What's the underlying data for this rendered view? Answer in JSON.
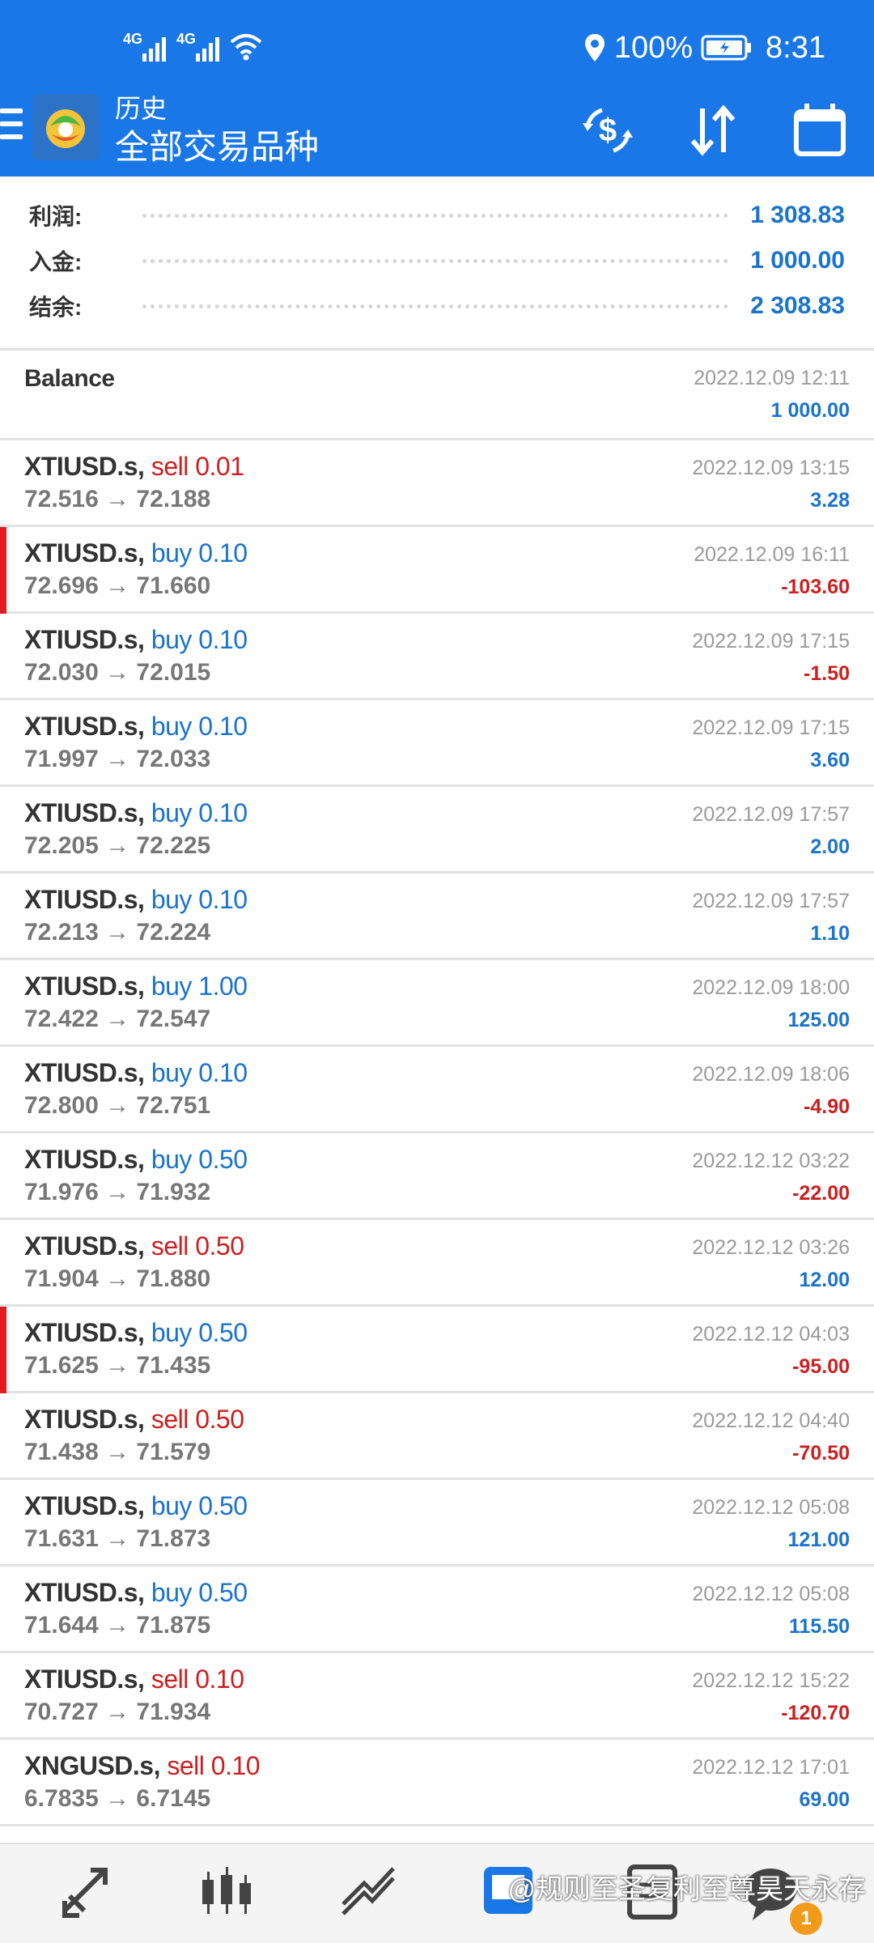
{
  "status_bar": {
    "signal1_label": "4G",
    "signal2_label": "4G",
    "battery_text": "100%",
    "time": "8:31"
  },
  "toolbar": {
    "subtitle": "历史",
    "title": "全部交易品种"
  },
  "summary": {
    "profit_label": "利润:",
    "profit_value": "1 308.83",
    "deposit_label": "入金:",
    "deposit_value": "1 000.00",
    "balance_label": "结余:",
    "balance_value": "2 308.83"
  },
  "balance_entry": {
    "label": "Balance",
    "time": "2022.12.09 12:11",
    "amount": "1 000.00"
  },
  "trades": [
    {
      "symbol": "XTIUSD.s,",
      "side": "sell 0.01",
      "dir": "sell",
      "prices": "72.516 → 72.188",
      "time": "2022.12.09 13:15",
      "profit": "3.28",
      "sign": "pos",
      "flag": false
    },
    {
      "symbol": "XTIUSD.s,",
      "side": "buy 0.10",
      "dir": "buy",
      "prices": "72.696 → 71.660",
      "time": "2022.12.09 16:11",
      "profit": "-103.60",
      "sign": "neg",
      "flag": true
    },
    {
      "symbol": "XTIUSD.s,",
      "side": "buy 0.10",
      "dir": "buy",
      "prices": "72.030 → 72.015",
      "time": "2022.12.09 17:15",
      "profit": "-1.50",
      "sign": "neg",
      "flag": false
    },
    {
      "symbol": "XTIUSD.s,",
      "side": "buy 0.10",
      "dir": "buy",
      "prices": "71.997 → 72.033",
      "time": "2022.12.09 17:15",
      "profit": "3.60",
      "sign": "pos",
      "flag": false
    },
    {
      "symbol": "XTIUSD.s,",
      "side": "buy 0.10",
      "dir": "buy",
      "prices": "72.205 → 72.225",
      "time": "2022.12.09 17:57",
      "profit": "2.00",
      "sign": "pos",
      "flag": false
    },
    {
      "symbol": "XTIUSD.s,",
      "side": "buy 0.10",
      "dir": "buy",
      "prices": "72.213 → 72.224",
      "time": "2022.12.09 17:57",
      "profit": "1.10",
      "sign": "pos",
      "flag": false
    },
    {
      "symbol": "XTIUSD.s,",
      "side": "buy 1.00",
      "dir": "buy",
      "prices": "72.422 → 72.547",
      "time": "2022.12.09 18:00",
      "profit": "125.00",
      "sign": "pos",
      "flag": false
    },
    {
      "symbol": "XTIUSD.s,",
      "side": "buy 0.10",
      "dir": "buy",
      "prices": "72.800 → 72.751",
      "time": "2022.12.09 18:06",
      "profit": "-4.90",
      "sign": "neg",
      "flag": false
    },
    {
      "symbol": "XTIUSD.s,",
      "side": "buy 0.50",
      "dir": "buy",
      "prices": "71.976 → 71.932",
      "time": "2022.12.12 03:22",
      "profit": "-22.00",
      "sign": "neg",
      "flag": false
    },
    {
      "symbol": "XTIUSD.s,",
      "side": "sell 0.50",
      "dir": "sell",
      "prices": "71.904 → 71.880",
      "time": "2022.12.12 03:26",
      "profit": "12.00",
      "sign": "pos",
      "flag": false
    },
    {
      "symbol": "XTIUSD.s,",
      "side": "buy 0.50",
      "dir": "buy",
      "prices": "71.625 → 71.435",
      "time": "2022.12.12 04:03",
      "profit": "-95.00",
      "sign": "neg",
      "flag": true
    },
    {
      "symbol": "XTIUSD.s,",
      "side": "sell 0.50",
      "dir": "sell",
      "prices": "71.438 → 71.579",
      "time": "2022.12.12 04:40",
      "profit": "-70.50",
      "sign": "neg",
      "flag": false
    },
    {
      "symbol": "XTIUSD.s,",
      "side": "buy 0.50",
      "dir": "buy",
      "prices": "71.631 → 71.873",
      "time": "2022.12.12 05:08",
      "profit": "121.00",
      "sign": "pos",
      "flag": false
    },
    {
      "symbol": "XTIUSD.s,",
      "side": "buy 0.50",
      "dir": "buy",
      "prices": "71.644 → 71.875",
      "time": "2022.12.12 05:08",
      "profit": "115.50",
      "sign": "pos",
      "flag": false
    },
    {
      "symbol": "XTIUSD.s,",
      "side": "sell 0.10",
      "dir": "sell",
      "prices": "70.727 → 71.934",
      "time": "2022.12.12 15:22",
      "profit": "-120.70",
      "sign": "neg",
      "flag": false
    },
    {
      "symbol": "XNGUSD.s,",
      "side": "sell 0.10",
      "dir": "sell",
      "prices": "6.7835 → 6.7145",
      "time": "2022.12.12 17:01",
      "profit": "69.00",
      "sign": "pos",
      "flag": false
    }
  ],
  "colors": {
    "header_blue": "#1a77e8",
    "buy_blue": "#1a73cc",
    "sell_red": "#cc1f1f",
    "flag_red": "#e11b22"
  },
  "bottom_nav": {
    "items": [
      "quotes-icon",
      "chart-icon",
      "trade-icon",
      "history-icon",
      "messages-icon",
      "chat-icon"
    ],
    "watermark": "@规则至圣复利至尊昊天永存",
    "badge": "1"
  }
}
